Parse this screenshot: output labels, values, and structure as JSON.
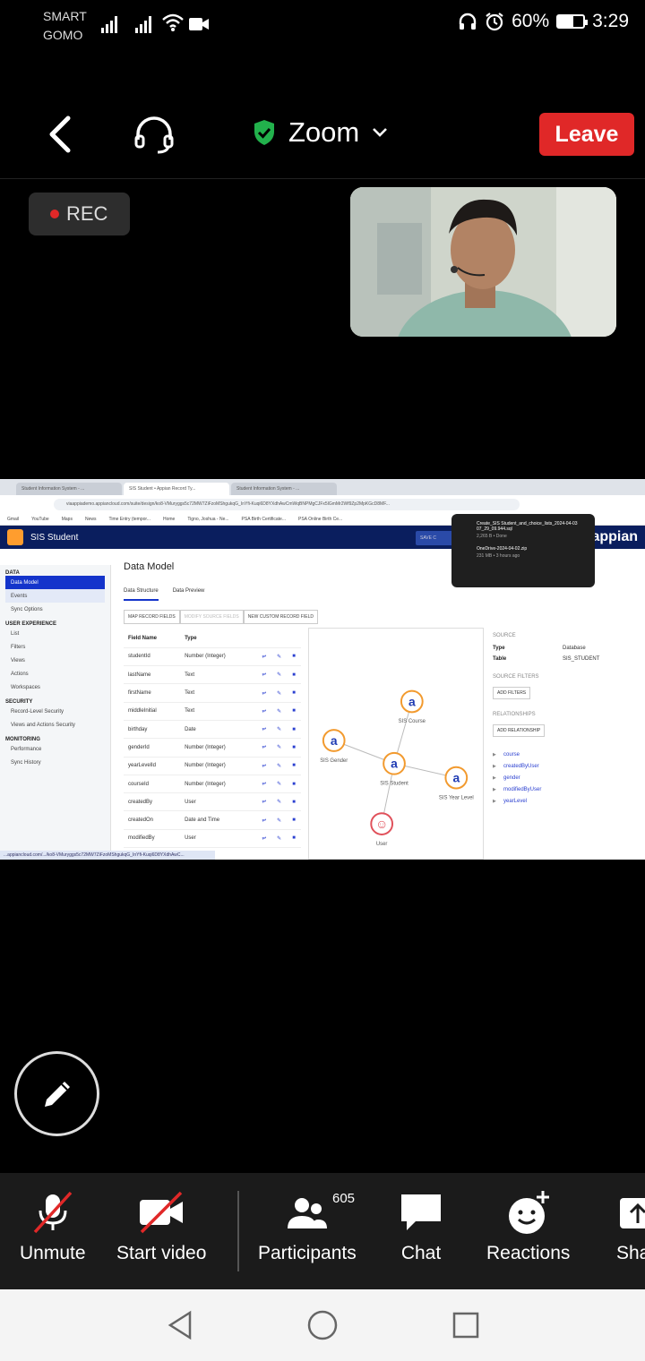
{
  "status": {
    "carrier_line1": "SMART",
    "carrier_line2": "GOMO",
    "battery": "60%",
    "battery_level": 0.6,
    "time": "3:29"
  },
  "header": {
    "meeting_name": "Zoom",
    "leave_label": "Leave"
  },
  "rec_label": "REC",
  "shared_screen": {
    "tabs": [
      "Student Information System - ...",
      "SIS Student • Appian Record Ty...",
      "Student Information System - ..."
    ],
    "url": "viaappiademo.appiancloud.com/suite/design/ko8-VMuryggs5c72MW7ZiFzoMShgukqG_InYfi-Kuqi6D8YXdhAwCmWqBNPMgCJFx5lGmMr2Wf9Zp2MpKGcD8MF...",
    "bookmarks": [
      "Gmail",
      "YouTube",
      "Maps",
      "News",
      "Time Entry (tempor...",
      "Home",
      "Tigno, Joshua - Ne...",
      "PSA Birth Certificate...",
      "PSA Online Birth Ce..."
    ],
    "app_title": "SIS Student",
    "save_label": "SAVE C",
    "brand": "appian",
    "nav": [
      {
        "header": "DATA",
        "items": [
          "Data Model",
          "Events",
          "Sync Options"
        ]
      },
      {
        "header": "USER EXPERIENCE",
        "items": [
          "List",
          "Filters",
          "Views",
          "Actions",
          "Workspaces"
        ]
      },
      {
        "header": "SECURITY",
        "items": [
          "Record-Level Security",
          "Views and Actions Security"
        ]
      },
      {
        "header": "MONITORING",
        "items": [
          "Performance",
          "Sync History"
        ]
      }
    ],
    "page_title": "Data Model",
    "subtabs": [
      "Data Structure",
      "Data Preview"
    ],
    "action_buttons": [
      "MAP RECORD FIELDS",
      "MODIFY SOURCE FIELDS",
      "NEW CUSTOM RECORD FIELD"
    ],
    "table_headers": [
      "Field Name",
      "Type"
    ],
    "fields": [
      [
        "studentId",
        "Number (Integer)"
      ],
      [
        "lastName",
        "Text"
      ],
      [
        "firstName",
        "Text"
      ],
      [
        "middleInitial",
        "Text"
      ],
      [
        "birthday",
        "Date"
      ],
      [
        "genderId",
        "Number (Integer)"
      ],
      [
        "yearLevelId",
        "Number (Integer)"
      ],
      [
        "courseId",
        "Number (Integer)"
      ],
      [
        "createdBy",
        "User"
      ],
      [
        "createdOn",
        "Date and Time"
      ],
      [
        "modifiedBy",
        "User"
      ]
    ],
    "diagram_nodes": [
      "SIS Course",
      "SIS Gender",
      "SIS Student",
      "SIS Year Level",
      "User"
    ],
    "source_header": "SOURCE",
    "source_type_label": "Type",
    "source_type_value": "Database",
    "source_table_label": "Table",
    "source_table_value": "SIS_STUDENT",
    "source_filters_header": "SOURCE FILTERS",
    "add_filters": "ADD FILTERS",
    "relationships_header": "RELATIONSHIPS",
    "add_relationship": "ADD RELATIONSHIP",
    "relationships": [
      "course",
      "createdByUser",
      "gender",
      "modifiedByUser",
      "yearLevel"
    ],
    "downloads": [
      {
        "name": "Create_SIS Student_and_choice_lists_2024-04-03 07_29_09.944.sql",
        "meta": "2,265 B • Done"
      },
      {
        "name": "OneDrive-2024-04-02.zip",
        "meta": "231 MB • 3 hours ago"
      }
    ],
    "status_link": "...appiancloud.com/.../ko8-VMuryggs5c72MW7ZiFzoMShgukqG_InYfi-Kuqi6D8YXdhAwC..."
  },
  "toolbar": {
    "unmute": "Unmute",
    "start_video": "Start video",
    "participants": "Participants",
    "participant_count": "605",
    "chat": "Chat",
    "reactions": "Reactions",
    "share": "Sha"
  },
  "colors": {
    "leave_red": "#e02828",
    "shield_green": "#22b14c",
    "appian_navy": "#0a1e5e",
    "appian_blue": "#1434cb"
  }
}
